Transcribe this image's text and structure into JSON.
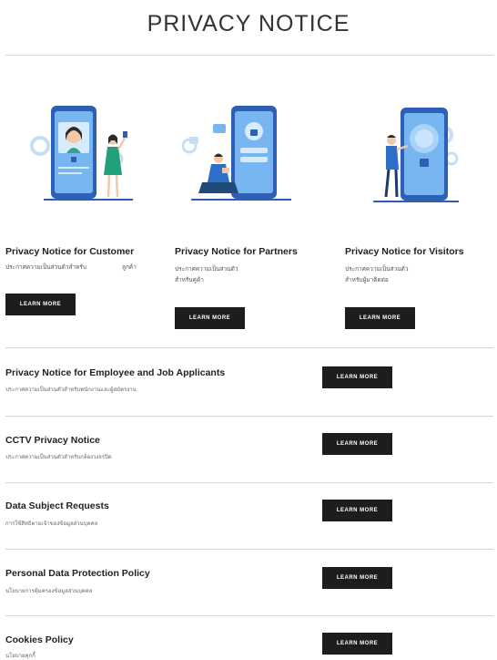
{
  "page": {
    "title": "PRIVACY NOTICE"
  },
  "cards": [
    {
      "title": "Privacy Notice for Customer",
      "desc": "ประกาศความเป็นส่วนตัวสำหรับ",
      "desc_extra": "ลูกค้า",
      "button": "LEARN MORE"
    },
    {
      "title": "Privacy Notice for Partners",
      "desc": "ประกาศความเป็นส่วนตัว",
      "desc2": "สำหรับคู่ค้า",
      "button": "LEARN MORE"
    },
    {
      "title": "Privacy Notice for  Visitors",
      "desc": "ประกาศความเป็นส่วนตัว",
      "desc2": "สำหรับผู้มาติดต่อ",
      "button": "LEARN MORE"
    }
  ],
  "rows": [
    {
      "title": "Privacy Notice for Employee and Job Applicants",
      "desc": "ประกาศความเป็นส่วนตัวสำหรับพนักงานและผู้สมัครงาน",
      "button": "LEARN MORE"
    },
    {
      "title": "CCTV Privacy Notice",
      "desc": "ประกาศความเป็นส่วนตัวสำหรับกล้องวงจรปิด",
      "button": "LEARN MORE"
    },
    {
      "title": "Data Subject Requests",
      "desc": "การใช้สิทธิตามเจ้าของข้อมูลส่วนบุคคล",
      "button": "LEARN MORE"
    },
    {
      "title": "Personal Data Protection Policy",
      "desc": "นโยบายการคุ้มครองข้อมูลส่วนบุคคล",
      "button": "LEARN MORE"
    },
    {
      "title": "Cookies Policy",
      "desc": "นโยบายคุกกี้",
      "button": "LEARN MORE"
    }
  ],
  "colors": {
    "accent_blue": "#3f8fe6",
    "light_blue": "#bcdcf7",
    "button_bg": "#1d1d1d"
  }
}
